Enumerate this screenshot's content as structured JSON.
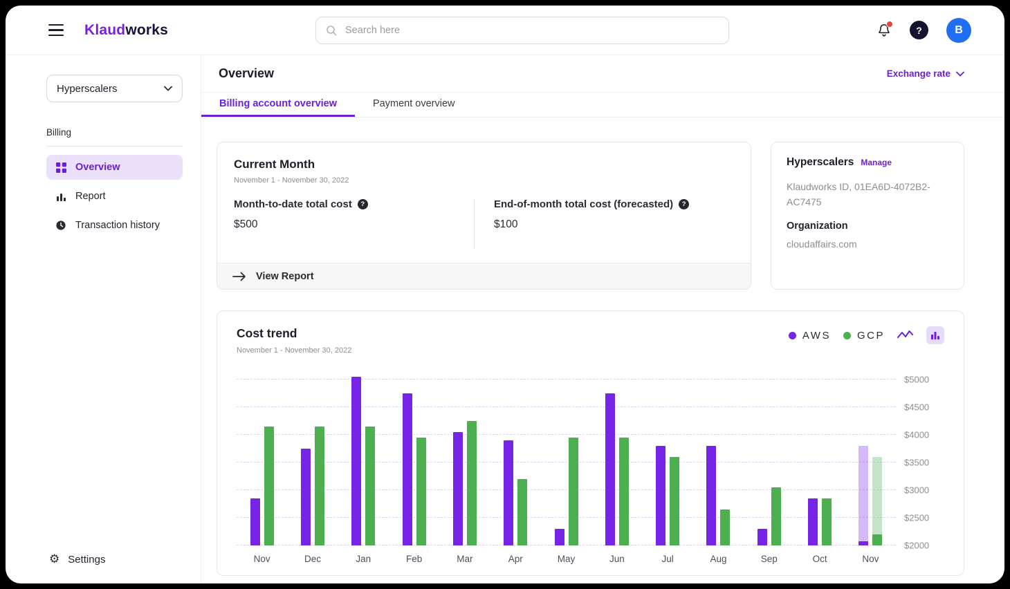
{
  "colors": {
    "accent": "#6B1FD8",
    "aws": "#7625E6",
    "gcp": "#4CAF50",
    "avatar": "#1F6FF0",
    "notification_badge": "#E8443A"
  },
  "header": {
    "logo_part1": "Klaud",
    "logo_part2": "works",
    "search_placeholder": "Search here",
    "help_glyph": "?",
    "avatar_initial": "B"
  },
  "sidebar": {
    "scope_selector": "Hyperscalers",
    "section_label": "Billing",
    "items": [
      {
        "label": "Overview",
        "active": true
      },
      {
        "label": "Report",
        "active": false
      },
      {
        "label": "Transaction history",
        "active": false
      }
    ],
    "settings_label": "Settings"
  },
  "page": {
    "title": "Overview",
    "exchange_rate_label": "Exchange rate",
    "tabs": [
      {
        "label": "Billing account overview",
        "active": true
      },
      {
        "label": "Payment overview",
        "active": false
      }
    ]
  },
  "current_month": {
    "title": "Current Month",
    "date_range": "November 1 - November 30, 2022",
    "stats": [
      {
        "label": "Month-to-date total cost",
        "value": "$500"
      },
      {
        "label": "End-of-month total cost (forecasted)",
        "value": "$100"
      }
    ],
    "view_report_label": "View Report"
  },
  "account_card": {
    "title": "Hyperscalers",
    "manage_label": "Manage",
    "account_id": "Klaudworks ID, 01EA6D-4072B2-AC7475",
    "org_label": "Organization",
    "org_value": "cloudaffairs.com"
  },
  "icons": {
    "info_glyph": "?"
  },
  "chart_card": {
    "title": "Cost trend",
    "date_range": "November 1 - November 30, 2022"
  },
  "chart_data": {
    "type": "bar",
    "title": "Cost trend",
    "subtitle": "November 1 - November 30, 2022",
    "categories": [
      "Nov",
      "Dec",
      "Jan",
      "Feb",
      "Mar",
      "Apr",
      "May",
      "Jun",
      "Jul",
      "Aug",
      "Sep",
      "Oct",
      "Nov"
    ],
    "series": [
      {
        "name": "AWS",
        "color": "#7625E6",
        "values": [
          2850,
          3750,
          5050,
          4750,
          4050,
          3900,
          2300,
          4750,
          3800,
          3800,
          2300,
          2850,
          3800
        ]
      },
      {
        "name": "GCP",
        "color": "#4CAF50",
        "values": [
          4150,
          4150,
          4150,
          3950,
          4250,
          3200,
          3950,
          3950,
          3600,
          2650,
          3050,
          2850,
          3600
        ]
      }
    ],
    "forecast_last_category": true,
    "last_category_actuals": {
      "AWS": 2075,
      "GCP": 2200
    },
    "ylim": [
      2000,
      5125
    ],
    "yticks": [
      5000,
      4500,
      4000,
      3500,
      3000,
      2500,
      2000
    ],
    "ytick_labels": [
      "$5000",
      "$4500",
      "$4000",
      "$3500",
      "$3000",
      "$2500",
      "$2000"
    ],
    "grid": "dashed-horizontal",
    "legend_position": "top-right"
  }
}
